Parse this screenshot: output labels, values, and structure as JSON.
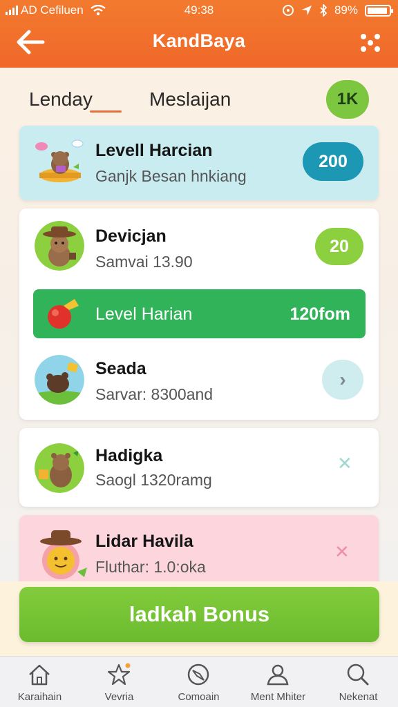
{
  "status_bar": {
    "carrier": "AD Cefiluen",
    "time": "49:38",
    "battery": "89%"
  },
  "header": {
    "title": "KandBaya"
  },
  "tabs": [
    {
      "label": "Lenday"
    },
    {
      "label": "Meslaijan"
    }
  ],
  "coin_badge": "1K",
  "items": [
    {
      "title": "Levell Harcian",
      "subtitle": "Ganjk Besan hnkiang",
      "value": "200"
    },
    {
      "title": "Devicjan",
      "subtitle": "Samvai 13.90",
      "value": "20"
    },
    {
      "title": "Seada",
      "subtitle": "Sarvar: 8300and",
      "action_icon": "chevron-right-icon"
    },
    {
      "title": "Hadigka",
      "subtitle": "Saogl 1320ramg",
      "action_icon": "close-icon"
    },
    {
      "title": "Lidar Havila",
      "subtitle": "Fluthar: 1.0:oka",
      "action_icon": "close-icon"
    }
  ],
  "highlight_bar": {
    "label": "Level Harian",
    "value": "120fom"
  },
  "action_button": {
    "label": "ladkah Bonus"
  },
  "bottom_nav": [
    {
      "label": "Karaihain",
      "icon": "home-icon"
    },
    {
      "label": "Vevria",
      "icon": "star-icon"
    },
    {
      "label": "Comoain",
      "icon": "compass-icon"
    },
    {
      "label": "Ment Mhiter",
      "icon": "profile-icon"
    },
    {
      "label": "Nekenat",
      "icon": "search-icon"
    }
  ],
  "colors": {
    "header": "#f0682a",
    "accent_green": "#31b35a",
    "button_green": "#78c436",
    "teal": "#1c97b4",
    "lime": "#8ccf3f"
  }
}
